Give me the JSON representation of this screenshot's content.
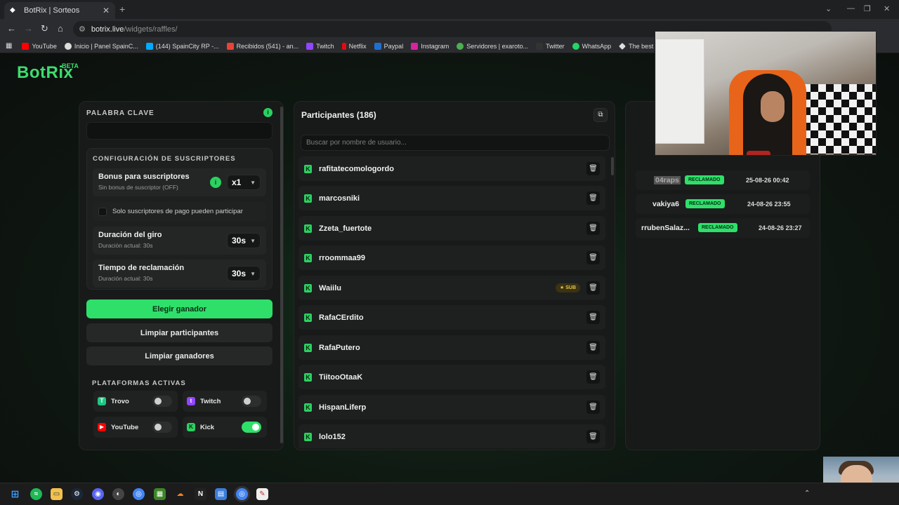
{
  "browser": {
    "tab_title": "BotRix | Sorteos",
    "url_host": "botrix.live",
    "url_path": "/widgets/raffles/",
    "bookmarks": [
      {
        "label": "YouTube",
        "color": "#ff0000"
      },
      {
        "label": "Inicio | Panel SpainC...",
        "color": "#dddddd"
      },
      {
        "label": "(144) SpainCity RP -...",
        "color": "#00aaff"
      },
      {
        "label": "Recibidos (541) - an...",
        "color": "#ea4335"
      },
      {
        "label": "Twitch",
        "color": "#9146ff"
      },
      {
        "label": "Netflix",
        "color": "#e50914"
      },
      {
        "label": "Paypal",
        "color": "#1f6fd1"
      },
      {
        "label": "Instagram",
        "color": "#d6249f"
      },
      {
        "label": "Servidores | exaroto...",
        "color": "#4caf50"
      },
      {
        "label": "Twitter",
        "color": "#dddddd"
      },
      {
        "label": "WhatsApp",
        "color": "#25d366"
      },
      {
        "label": "The best streaming...",
        "color": "#dddddd"
      }
    ]
  },
  "app": {
    "logo": "BotRix",
    "beta": "BETA",
    "accent": "#2ee06a"
  },
  "left": {
    "keyword_label": "PALABRA CLAVE",
    "keyword_value": "",
    "subs_config_label": "CONFIGURACIÓN DE SUSCRIPTORES",
    "bonus_title": "Bonus para suscriptores",
    "bonus_sub": "Sin bonus de suscriptor (OFF)",
    "bonus_value": "x1",
    "paid_only_label": "Solo suscriptores de pago pueden participar",
    "spin_title": "Duración del giro",
    "spin_sub": "Duración actual: 30s",
    "spin_value": "30s",
    "claim_title": "Tiempo de reclamación",
    "claim_sub": "Duración actual: 30s",
    "claim_value": "30s",
    "choose_winner": "Elegir ganador",
    "clear_participants": "Limpiar participantes",
    "clear_winners": "Limpiar ganadores",
    "platforms_label": "PLATAFORMAS ACTIVAS",
    "platforms": [
      {
        "name": "Trovo",
        "on": false
      },
      {
        "name": "Twitch",
        "on": false
      },
      {
        "name": "YouTube",
        "on": false
      },
      {
        "name": "Kick",
        "on": true
      }
    ]
  },
  "participants": {
    "title": "Participantes (186)",
    "search_placeholder": "Buscar por nombre de usuario...",
    "sub_badge": "SUB",
    "items": [
      {
        "name": "rafitatecomologordo",
        "sub": false
      },
      {
        "name": "marcosniki",
        "sub": false
      },
      {
        "name": "Zzeta_fuertote",
        "sub": false
      },
      {
        "name": "rroommaa99",
        "sub": false
      },
      {
        "name": "Waiilu",
        "sub": true
      },
      {
        "name": "RafaCErdito",
        "sub": false
      },
      {
        "name": "RafaPutero",
        "sub": false
      },
      {
        "name": "TiitooOtaaK",
        "sub": false
      },
      {
        "name": "HispanLiferp",
        "sub": false
      },
      {
        "name": "lolo152",
        "sub": false
      }
    ]
  },
  "winners": {
    "claimed_label": "RECLAMADO",
    "items": [
      {
        "name": "04raps",
        "date": "25-08-26 00:42"
      },
      {
        "name": "vakiya6",
        "date": "24-08-26 23:55"
      },
      {
        "name": "rrubenSalaz...",
        "date": "24-08-26 23:27"
      }
    ]
  }
}
